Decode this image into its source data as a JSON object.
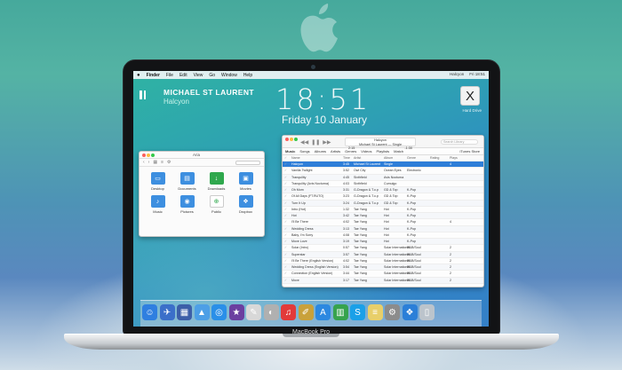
{
  "menubar": {
    "app_name": "Finder",
    "items": [
      "File",
      "Edit",
      "View",
      "Go",
      "Window",
      "Help"
    ],
    "right": [
      "Halcyon",
      "Fri 18:51"
    ]
  },
  "now_playing": {
    "artist": "MICHAEL ST LAURENT",
    "track": "Halcyon"
  },
  "clock": {
    "time": "18:51",
    "date": "Friday 10 January"
  },
  "hard_drive": {
    "glyph": "X",
    "label": "Hard Drive"
  },
  "finder": {
    "title": "Aria",
    "folders": [
      {
        "label": "Desktop",
        "icon": "desktop-icon",
        "glyph": "▭"
      },
      {
        "label": "Documents",
        "icon": "documents-icon",
        "glyph": "▤"
      },
      {
        "label": "Downloads",
        "icon": "downloads-icon",
        "glyph": "↓"
      },
      {
        "label": "Movies",
        "icon": "movies-icon",
        "glyph": "▣"
      },
      {
        "label": "Music",
        "icon": "music-icon",
        "glyph": "♪"
      },
      {
        "label": "Pictures",
        "icon": "pictures-icon",
        "glyph": "◉"
      },
      {
        "label": "Public",
        "icon": "public-icon",
        "glyph": "⊕"
      },
      {
        "label": "Dropbox",
        "icon": "dropbox-icon",
        "glyph": "❖"
      }
    ]
  },
  "itunes": {
    "lcd_title": "Halcyon",
    "lcd_artist": "Michael St Laurent — Single",
    "lcd_time_left": "2:15",
    "lcd_time_right": "-1:30",
    "search_placeholder": "Search Library",
    "tabs": [
      "Music",
      "Songs",
      "Albums",
      "Artists",
      "Genres",
      "Videos",
      "Playlists",
      "Match"
    ],
    "store_label": "iTunes Store",
    "columns": [
      "Name",
      "Time",
      "Artist",
      "Album",
      "Genre",
      "Rating",
      "Plays"
    ],
    "rows": [
      [
        "Halcyon",
        "3:45",
        "Michael St Laurent",
        "Single",
        "",
        "",
        "4"
      ],
      [
        "Vanilla Twilight",
        "3:52",
        "Owl City",
        "Ocean Eyes",
        "Electronic",
        "",
        ""
      ],
      [
        "Tranquility",
        "4:45",
        "Sixthfield",
        "Avis Nocturna",
        "",
        "",
        ""
      ],
      [
        "Tranquility (Avis Nocturna)",
        "4:03",
        "Sixthfield",
        "Cumulgo",
        "",
        "",
        ""
      ],
      [
        "Oh Mom",
        "3:31",
        "G-Dragon & T.o.p",
        "GD & Top",
        "K-Pop",
        "",
        ""
      ],
      [
        "Of All Days (FT.RUTO)",
        "3:23",
        "G-Dragon & T.o.p",
        "GD & Top",
        "K-Pop",
        "",
        ""
      ],
      [
        "Turn It Up",
        "3:24",
        "G-Dragon & T.o.p",
        "GD & Top",
        "K-Pop",
        "",
        ""
      ],
      [
        "Intro (Hot)",
        "1:32",
        "Tae Yang",
        "Hot",
        "K-Pop",
        "",
        ""
      ],
      [
        "Hot",
        "3:42",
        "Tae Yang",
        "Hot",
        "K-Pop",
        "",
        ""
      ],
      [
        "I'll Be There",
        "4:02",
        "Tae Yang",
        "Hot",
        "K-Pop",
        "",
        "4"
      ],
      [
        "Wedding Dress",
        "3:13",
        "Tae Yang",
        "Hot",
        "K-Pop",
        "",
        ""
      ],
      [
        "Baby, I'm Sorry",
        "4:08",
        "Tae Yang",
        "Hot",
        "K-Pop",
        "",
        ""
      ],
      [
        "Move Love",
        "3:19",
        "Tae Yang",
        "Hot",
        "K-Pop",
        "",
        ""
      ],
      [
        "Solar (Intro)",
        "0:57",
        "Tae Yang",
        "Solar International",
        "R&B/Soul",
        "",
        "2"
      ],
      [
        "Superstar",
        "3:57",
        "Tae Yang",
        "Solar International",
        "R&B/Soul",
        "",
        "2"
      ],
      [
        "I'll Be There (English Version)",
        "4:02",
        "Tae Yang",
        "Solar International",
        "R&B/Soul",
        "",
        "2"
      ],
      [
        "Wedding Dress (English Version)",
        "3:54",
        "Tae Yang",
        "Solar International",
        "R&B/Soul",
        "",
        "2"
      ],
      [
        "Connection (English Version)",
        "3:44",
        "Tae Yang",
        "Solar International",
        "R&B/Soul",
        "",
        "2"
      ],
      [
        "Move",
        "3:17",
        "Tae Yang",
        "Solar International",
        "R&B/Soul",
        "",
        "2"
      ]
    ]
  },
  "dock": {
    "icons": [
      {
        "name": "finder-icon",
        "glyph": "☺",
        "color": "#2f7fe0"
      },
      {
        "name": "launchpad-icon",
        "glyph": "✈",
        "color": "#3b6fc9"
      },
      {
        "name": "mission-control-icon",
        "glyph": "▦",
        "color": "#3c5ea8"
      },
      {
        "name": "keynote-icon",
        "glyph": "▲",
        "color": "#4d9fe6"
      },
      {
        "name": "safari-icon",
        "glyph": "◎",
        "color": "#2a8fe8"
      },
      {
        "name": "imovie-icon",
        "glyph": "★",
        "color": "#6b3fa0"
      },
      {
        "name": "textedit-icon",
        "glyph": "✎",
        "color": "#d8d8d8"
      },
      {
        "name": "photos-icon",
        "glyph": "◐",
        "color": "#b0b0b0"
      },
      {
        "name": "itunes-icon",
        "glyph": "♫",
        "color": "#e23a3a"
      },
      {
        "name": "pencil-icon",
        "glyph": "✐",
        "color": "#c9a13a"
      },
      {
        "name": "app-store-icon",
        "glyph": "A",
        "color": "#2c88e0"
      },
      {
        "name": "numbers-icon",
        "glyph": "▥",
        "color": "#37a34d"
      },
      {
        "name": "skype-icon",
        "glyph": "S",
        "color": "#1aa0e8"
      },
      {
        "name": "notes-icon",
        "glyph": "≡",
        "color": "#e8cf6a"
      },
      {
        "name": "system-preferences-icon",
        "glyph": "⚙",
        "color": "#8c8c8c"
      },
      {
        "name": "dropbox-dock-icon",
        "glyph": "❖",
        "color": "#2b7fd8"
      },
      {
        "name": "trash-icon",
        "glyph": "▯",
        "color": "#bcc4cc"
      }
    ]
  },
  "laptop": {
    "brand": "MacBook Pro"
  }
}
